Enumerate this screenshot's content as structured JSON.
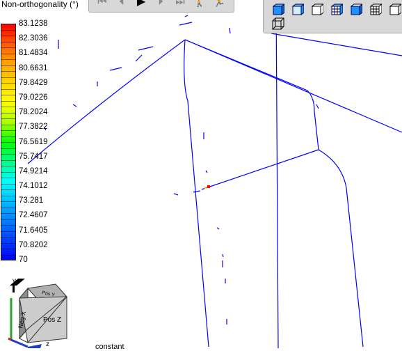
{
  "legend": {
    "title": "Non-orthogonality (°)",
    "ticks": [
      "83.1238",
      "82.3036",
      "81.4834",
      "80.6631",
      "79.8429",
      "79.0226",
      "78.2024",
      "77.3822",
      "76.5619",
      "75.7417",
      "74.9214",
      "74.1012",
      "73.281",
      "72.4607",
      "71.6405",
      "70.8202",
      "70"
    ],
    "colormap": "rainbow",
    "colors": [
      "#ff0000",
      "#ff5a00",
      "#ffa500",
      "#ffd700",
      "#ffff00",
      "#aaff00",
      "#00ff00",
      "#00ff88",
      "#00ffff",
      "#00bfff",
      "#0080ff",
      "#0040ff",
      "#0000ff"
    ]
  },
  "animation_toolbar": {
    "buttons": [
      "first-frame-icon",
      "previous-frame-icon",
      "play-icon",
      "next-frame-icon",
      "last-frame-icon",
      "walk-icon",
      "run-icon"
    ]
  },
  "view_toolbar": {
    "buttons": [
      "view-blue-cube-icon",
      "view-blue-cube-2-icon",
      "view-outline-cube-icon",
      "view-grid-cube-icon",
      "view-blue-cube-3-icon",
      "view-grid-cube-2-icon",
      "view-outline-cube-2-icon",
      "view-wireframe-cube-icon"
    ]
  },
  "orientation": {
    "cube_front_label": "Pos Z",
    "cube_side_label": "Neg X",
    "cube_top_label": "Pos Y",
    "y_axis_label": "y",
    "z_axis_label": "z"
  },
  "footer_text": "constant",
  "colors": {
    "mesh_edge": "#0000ff",
    "toolbar_bg": "#d8d8d8"
  }
}
